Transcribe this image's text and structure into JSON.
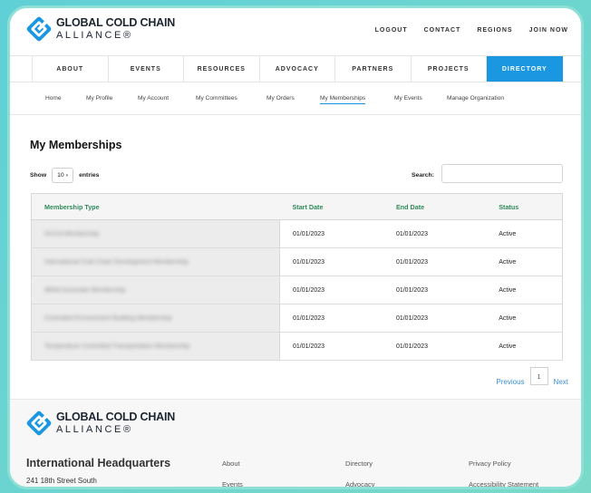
{
  "brand": {
    "line1": "GLOBAL COLD CHAIN",
    "line2": "ALLIANCE®"
  },
  "top_links": [
    "LOGOUT",
    "CONTACT",
    "REGIONS",
    "JOIN NOW"
  ],
  "main_nav": [
    "ABOUT",
    "EVENTS",
    "RESOURCES",
    "ADVOCACY",
    "PARTNERS",
    "PROJECTS",
    "DIRECTORY"
  ],
  "main_nav_active": "DIRECTORY",
  "sub_nav": [
    "Home",
    "My Profile",
    "My Account",
    "My Committees",
    "My Orders",
    "My Memberships",
    "My Events",
    "Manage Organization"
  ],
  "sub_nav_active": "My Memberships",
  "page_title": "My Memberships",
  "show_label": "Show",
  "entries_value": "10",
  "entries_label": "entries",
  "search_label": "Search:",
  "search_value": "",
  "table": {
    "headers": [
      "Membership Type",
      "Start Date",
      "End Date",
      "Status"
    ],
    "rows": [
      [
        "GCCA Membership",
        "01/01/2023",
        "01/01/2023",
        "Active"
      ],
      [
        "International Cold Chain Development Membership",
        "01/01/2023",
        "01/01/2023",
        "Active"
      ],
      [
        "IBWA Associate Membership",
        "01/01/2023",
        "01/01/2023",
        "Active"
      ],
      [
        "Controlled Environment Building Membership",
        "01/01/2023",
        "01/01/2023",
        "Active"
      ],
      [
        "Temperature Controlled Transportation Membership",
        "01/01/2023",
        "01/01/2023",
        "Active"
      ]
    ]
  },
  "pagination": {
    "previous": "Previous",
    "current": "1",
    "next": "Next"
  },
  "footer": {
    "hq_title": "International Headquarters",
    "address": "241 18th Street South",
    "col1": [
      "About",
      "Events"
    ],
    "col2": [
      "Directory",
      "Advocacy"
    ],
    "col3": [
      "Privacy Policy",
      "Accessibility Statement"
    ]
  },
  "colors": {
    "accent": "#1a97e0",
    "header_green": "#2e8b5a",
    "link_blue": "#3b8fd6"
  }
}
